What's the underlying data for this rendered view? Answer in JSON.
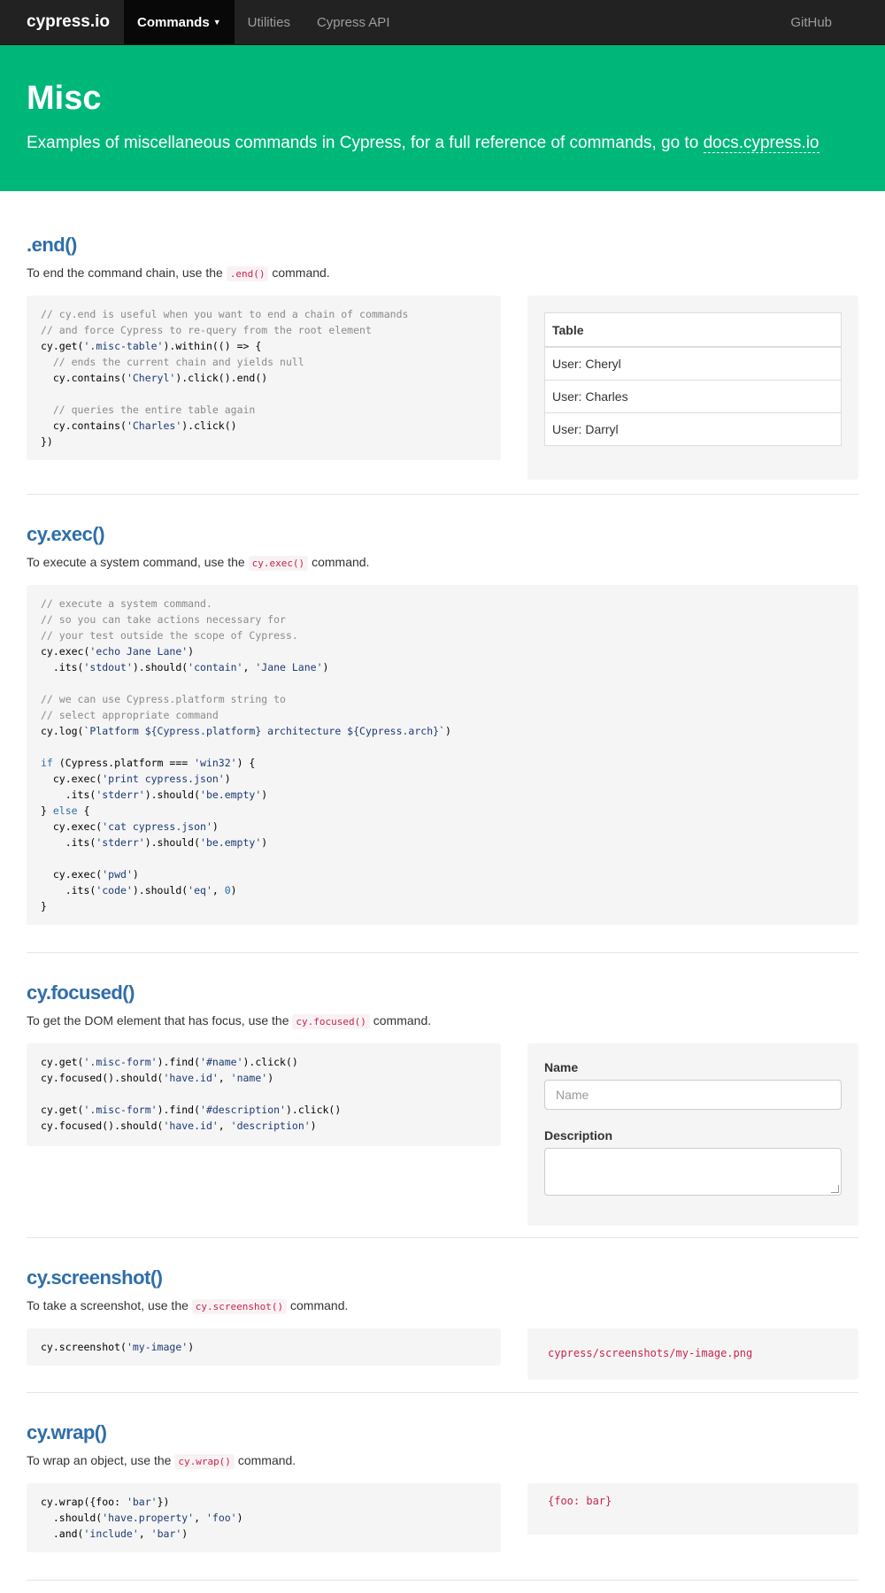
{
  "nav": {
    "brand": "cypress.io",
    "items": [
      {
        "label": "Commands",
        "active": true
      },
      {
        "label": "Utilities"
      },
      {
        "label": "Cypress API"
      }
    ],
    "github": "GitHub"
  },
  "hero": {
    "title": "Misc",
    "subtitle": "Examples of miscellaneous commands in Cypress, for a full reference of commands, go to ",
    "link": "docs.cypress.io"
  },
  "sections": {
    "end": {
      "title": ".end()",
      "desc_pre": "To end the command chain, use the ",
      "desc_code": ".end()",
      "desc_post": " command.",
      "table": {
        "header": "Table",
        "rows": [
          "User: Cheryl",
          "User: Charles",
          "User: Darryl"
        ]
      }
    },
    "exec": {
      "title": "cy.exec()",
      "desc_pre": "To execute a system command, use the ",
      "desc_code": "cy.exec()",
      "desc_post": " command."
    },
    "focused": {
      "title": "cy.focused()",
      "desc_pre": "To get the DOM element that has focus, use the ",
      "desc_code": "cy.focused()",
      "desc_post": " command.",
      "form": {
        "name_label": "Name",
        "name_placeholder": "Name",
        "description_label": "Description"
      }
    },
    "screenshot": {
      "title": "cy.screenshot()",
      "desc_pre": "To take a screenshot, use the ",
      "desc_code": "cy.screenshot()",
      "desc_post": " command.",
      "output": "cypress/screenshots/my-image.png"
    },
    "wrap": {
      "title": "cy.wrap()",
      "desc_pre": "To wrap an object, use the ",
      "desc_code": "cy.wrap()",
      "desc_post": " command.",
      "output": "{foo: bar}"
    }
  },
  "colors": {
    "hero": "#00b77a",
    "navbar": "#222222",
    "heading": "#2f6ea9"
  }
}
